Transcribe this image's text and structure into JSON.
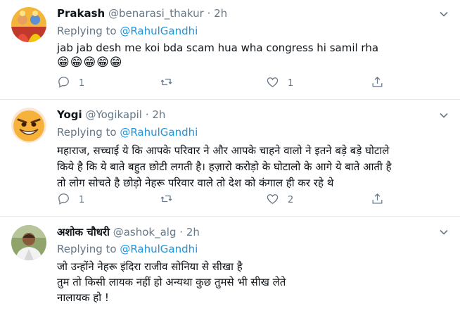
{
  "tweets": [
    {
      "name": "Prakash",
      "handle": "@benarasi_thakur",
      "sep": "·",
      "time": "2h",
      "replying_prefix": "Replying to ",
      "replying_to": "@RahulGandhi",
      "text": "jab jab desh me koi bda scam hua wha congress hi samil rha",
      "emoji": "😁😁😁😁😁",
      "reply_count": "1",
      "retweet_count": "",
      "like_count": "1"
    },
    {
      "name": "Yogi",
      "handle": "@Yogikapil",
      "sep": "·",
      "time": "2h",
      "replying_prefix": "Replying to ",
      "replying_to": "@RahulGandhi",
      "lines": [
        "महाराज, सच्चाई ये कि आपके परिवार ने और आपके चाहने वालो ने इतने बड़े बड़े घोटाले",
        "किये है कि ये बाते बहुत छोटी लगती है। हज़ारो करोड़ो के घोटालो के आगे ये बाते आती है",
        "तो लोग सोचते है छोड़ो नेहरू परिवार वाले तो देश को कंगाल ही कर रहे थे"
      ],
      "reply_count": "1",
      "retweet_count": "",
      "like_count": "2"
    },
    {
      "name": "अशोक चौधरी",
      "handle": "@ashok_alg",
      "sep": "·",
      "time": "2h",
      "replying_prefix": "Replying to ",
      "replying_to": "@RahulGandhi",
      "lines": [
        "जो उन्होंने नेहरू इंदिरा राजीव सोनिया से सीखा है",
        "तुम तो किसी लायक नहीं हो अन्यथा कुछ तुमसे भी सीख लेते",
        "नालायक हो !"
      ]
    }
  ],
  "colors": {
    "link": "#1b95e0",
    "muted": "#657786",
    "text": "#0f1419",
    "divider": "#e6ecf0"
  },
  "icons": [
    "chevron-down-icon",
    "reply-icon",
    "retweet-icon",
    "like-icon",
    "share-icon"
  ]
}
